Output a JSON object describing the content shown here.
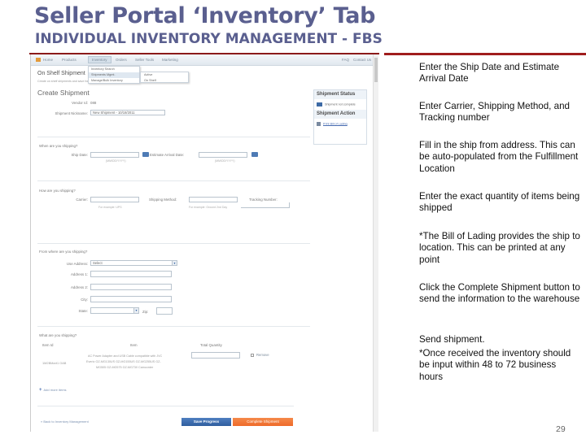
{
  "header": {
    "title": "Seller Portal ‘Inventory’ Tab",
    "subtitle": "INDIVIDUAL INVENTORY MANAGEMENT - FBS"
  },
  "screenshot": {
    "nav": {
      "items": [
        "Home",
        "Products",
        "Inventory",
        "Orders",
        "Seller Tools",
        "Marketing"
      ],
      "active_index": 2,
      "right_links": [
        "FAQ",
        "Contact Us"
      ]
    },
    "inventory_menu": [
      "Inventory Search",
      "Shipments Mgmt.",
      "Manage/Bulk Inventory"
    ],
    "shipments_submenu": [
      "Active",
      "On Shelf"
    ],
    "on_shelf_heading": "On Shelf Shipment",
    "description": "Create on shelf shipments and save for submission to store via online warehouse",
    "create_heading": "Create Shipment",
    "vendor_id_label": "Vendor Id:",
    "vendor_id_value": "088",
    "nickname_label": "Shipment Nickname:",
    "nickname_value": "New Shipment - 10/18/2011",
    "when": {
      "question": "When are you shipping?",
      "ship_date_label": "Ship Date:",
      "ship_date_value": "",
      "ship_date_hint": "(MM/DD/YYYY)",
      "arrival_label": "Estimate Arrival Date:",
      "arrival_value": "",
      "arrival_hint": "(MM/DD/YYYY)"
    },
    "how": {
      "question": "How are you shipping?",
      "carrier_label": "Carrier:",
      "carrier_value": "",
      "carrier_hint": "For example: UPS",
      "method_label": "Shipping Method:",
      "method_value": "",
      "method_hint": "For example: Ground 2nd Day",
      "tracking_label": "Tracking Number:",
      "tracking_value": ""
    },
    "from": {
      "question": "From where are you shipping?",
      "use_address_label": "Use Address:",
      "use_address_value": "Select",
      "address1_label": "Address 1:",
      "address2_label": "Address 2:",
      "city_label": "City:",
      "state_label": "State:",
      "zip_label": "Zip:"
    },
    "what": {
      "question": "What are you shipping?",
      "columns": [
        "Item Id",
        "Item",
        "Total Quantity"
      ],
      "rows": [
        {
          "item_id": "1M2BMart1 OAB",
          "item_lines": [
            "AC Power Adapter and USB Cable compatible with JVC",
            "Everio GZ-MG130US GZ-MG155US GZ-MG255US GZ-",
            "MG505 GZ-MG575 GZ-MG730 Camcorder"
          ],
          "quantity": "",
          "remove_label": "Remove"
        }
      ],
      "add_more_label": "Add more items"
    },
    "status_panel": {
      "status_heading": "Shipment Status",
      "status_text": "Shipment not complete",
      "action_heading": "Shipment Action",
      "action_link": "Print Bill of Lading"
    },
    "back_link": "« Back to Inventory Management",
    "save_button": "Save Progress",
    "complete_button": "Complete Shipment"
  },
  "notes": [
    "Enter the Ship Date and Estimate Arrival Date",
    "Enter Carrier, Shipping Method, and Tracking number",
    "Fill in the ship from address. This can be auto-populated from the Fulfillment Location",
    "Enter the exact quantity of items being shipped",
    "*The Bill of Lading provides the ship to location. This can be printed at any point",
    "Click the Complete Shipment button to send the information to the warehouse",
    "Send shipment.",
    "*Once received the inventory should be input within 48 to 72 business hours"
  ],
  "page_number": "29",
  "colors": {
    "title": "#5a5f8f",
    "rule": "#8b1a1a",
    "save_button": "#3a6aae",
    "complete_button": "#f07a3a"
  }
}
